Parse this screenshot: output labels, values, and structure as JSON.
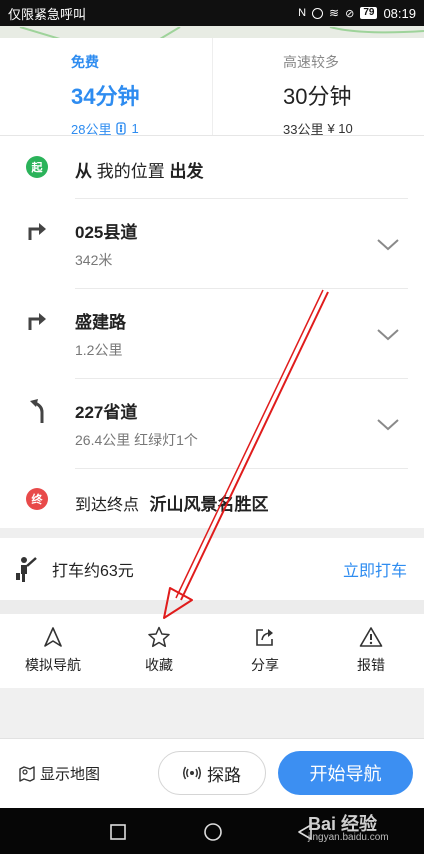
{
  "status_bar": {
    "left_text": "仅限紧急呼叫",
    "battery": "79",
    "time": "08:19"
  },
  "route_tabs": [
    {
      "tag": "免费",
      "duration": "34分钟",
      "meta1": "28公里",
      "meta2": "1",
      "active": true
    },
    {
      "tag": "高速较多",
      "duration": "30分钟",
      "meta1": "33公里",
      "meta2": "¥ 10",
      "active": false
    }
  ],
  "start": {
    "badge": "起",
    "prefix": "从",
    "place": "我的位置",
    "suffix": "出发"
  },
  "steps": [
    {
      "road": "025县道",
      "detail": "342米",
      "turn": "right"
    },
    {
      "road": "盛建路",
      "detail": "1.2公里",
      "turn": "right"
    },
    {
      "road": "227省道",
      "detail": "26.4公里 红绿灯1个",
      "turn": "left"
    }
  ],
  "end": {
    "badge": "终",
    "prefix": "到达终点",
    "place": "沂山风景名胜区"
  },
  "taxi": {
    "label": "打车约63元",
    "action": "立即打车"
  },
  "actions": [
    {
      "label": "模拟导航",
      "icon": "navigation-arrow-icon"
    },
    {
      "label": "收藏",
      "icon": "star-icon"
    },
    {
      "label": "分享",
      "icon": "share-icon"
    },
    {
      "label": "报错",
      "icon": "warning-icon"
    }
  ],
  "bottom": {
    "show_map": "显示地图",
    "probe": "探路",
    "start_nav": "开始导航"
  },
  "watermark": {
    "brand": "Bai 经验",
    "url": "jingyan.baidu.com"
  },
  "colors": {
    "accent": "#2e8cf0",
    "start_badge": "#2bb35a",
    "end_badge": "#e84a4a",
    "arrow": "#e01c1c"
  }
}
